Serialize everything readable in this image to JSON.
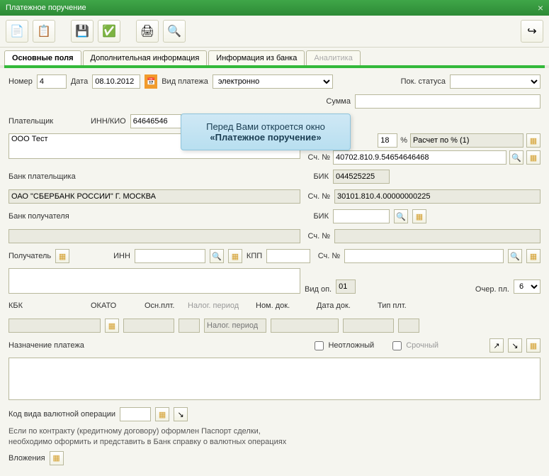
{
  "title": "Платежное поручение",
  "tabs": {
    "t1": "Основные поля",
    "t2": "Дополнительная информация",
    "t3": "Информация из банка",
    "t4": "Аналитика"
  },
  "row1": {
    "num_lbl": "Номер",
    "num": "4",
    "date_lbl": "Дата",
    "date": "08.10.2012",
    "type_lbl": "Вид платежа",
    "type": "электронно",
    "status_lbl": "Пок. статуса"
  },
  "row2": {
    "sum_lbl": "Сумма"
  },
  "payer": {
    "lbl": "Плательщик",
    "inn_lbl": "ИНН/КИО",
    "inn": "64646546",
    "name": "ООО Тест",
    "pct": "18",
    "pct_s": "%",
    "calc": "Расчет по % (1)",
    "acct_lbl": "Сч. №",
    "acct": "40702.810.9.54654646468"
  },
  "payer_bank": {
    "lbl": "Банк плательщика",
    "bik_lbl": "БИК",
    "bik": "044525225",
    "name": "ОАО \"СБЕРБАНК РОССИИ\" Г. МОСКВА",
    "acct_lbl": "Сч. №",
    "acct": "30101.810.4.00000000225"
  },
  "rec_bank": {
    "lbl": "Банк получателя",
    "bik_lbl": "БИК",
    "acct_lbl": "Сч. №"
  },
  "rec": {
    "lbl": "Получатель",
    "inn_lbl": "ИНН",
    "kpp_lbl": "КПП",
    "acct_lbl": "Сч. №",
    "vidop_lbl": "Вид оп.",
    "vidop": "01",
    "ocher_lbl": "Очер. пл.",
    "ocher": "6"
  },
  "budget": {
    "kbk": "КБК",
    "okato": "ОКАТО",
    "osn": "Осн.плт.",
    "nalog_ph": "Налог. период",
    "nom": "Ном. док.",
    "dat": "Дата док.",
    "tip": "Тип плт."
  },
  "purpose": {
    "lbl": "Назначение платежа",
    "urgent1": "Неотложный",
    "urgent2": "Срочный"
  },
  "currency": {
    "lbl": "Код вида валютной операции",
    "hint1": "Если по контракту (кредитному договору) оформлен Паспорт сделки,",
    "hint2": "необходимо оформить и представить в Банк справку о валютных операциях"
  },
  "attach": {
    "lbl": "Вложения"
  },
  "callout": {
    "l1": "Перед Вами откроется окно",
    "l2": "«Платежное поручение»"
  }
}
